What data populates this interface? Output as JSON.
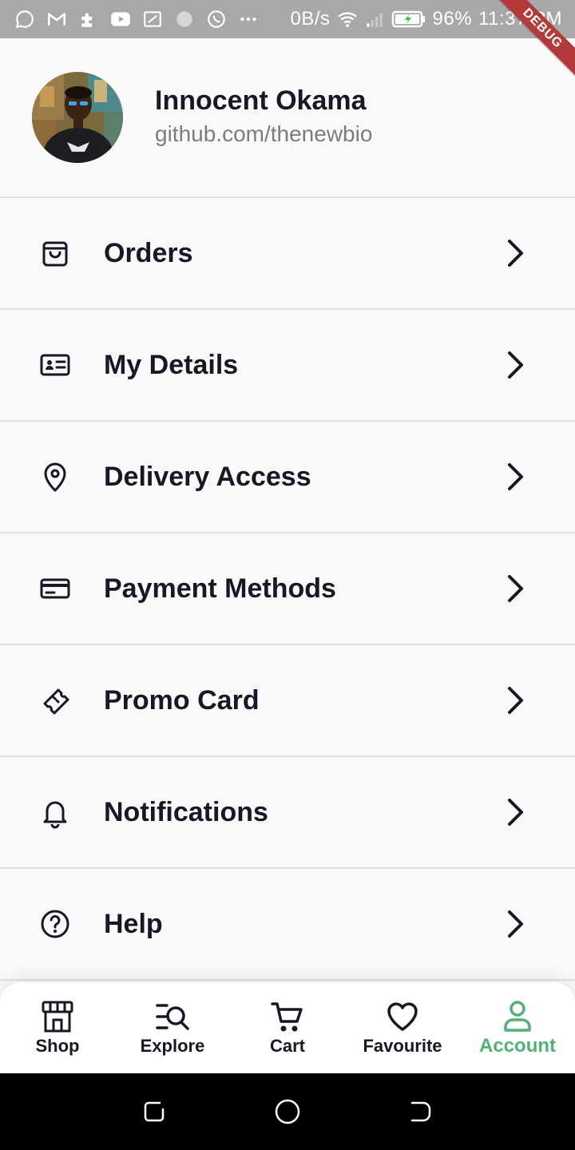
{
  "status_bar": {
    "net_speed": "0B/s",
    "battery": "96%",
    "time": "11:37 PM",
    "icons": [
      "chat-icon",
      "gmail-icon",
      "puzzle-icon",
      "youtube-icon",
      "screen-icon",
      "dot-icon",
      "whatsapp-icon",
      "more-icon",
      "wifi-icon",
      "signal-icon",
      "battery-icon"
    ]
  },
  "debug_label": "DEBUG",
  "profile": {
    "name": "Innocent Okama",
    "link": "github.com/thenewbio"
  },
  "menu": {
    "items": [
      {
        "label": "Orders",
        "icon": "shopping-bag-icon"
      },
      {
        "label": "My Details",
        "icon": "id-card-icon"
      },
      {
        "label": "Delivery Access",
        "icon": "location-pin-icon"
      },
      {
        "label": "Payment Methods",
        "icon": "credit-card-icon"
      },
      {
        "label": "Promo Card",
        "icon": "ticket-icon"
      },
      {
        "label": "Notifications",
        "icon": "bell-icon"
      },
      {
        "label": "Help",
        "icon": "help-circle-icon"
      }
    ]
  },
  "bottom_nav": {
    "items": [
      {
        "label": "Shop",
        "icon": "store-icon"
      },
      {
        "label": "Explore",
        "icon": "explore-search-icon"
      },
      {
        "label": "Cart",
        "icon": "cart-icon"
      },
      {
        "label": "Favourite",
        "icon": "heart-icon"
      },
      {
        "label": "Account",
        "icon": "user-icon"
      }
    ],
    "active": "Account"
  },
  "colors": {
    "accent": "#53b175",
    "text_dark": "#181725",
    "text_muted": "#7c7c7c",
    "divider": "#e2e2e2",
    "status_bar": "#a8a8a8",
    "debug": "#b43a3a"
  }
}
